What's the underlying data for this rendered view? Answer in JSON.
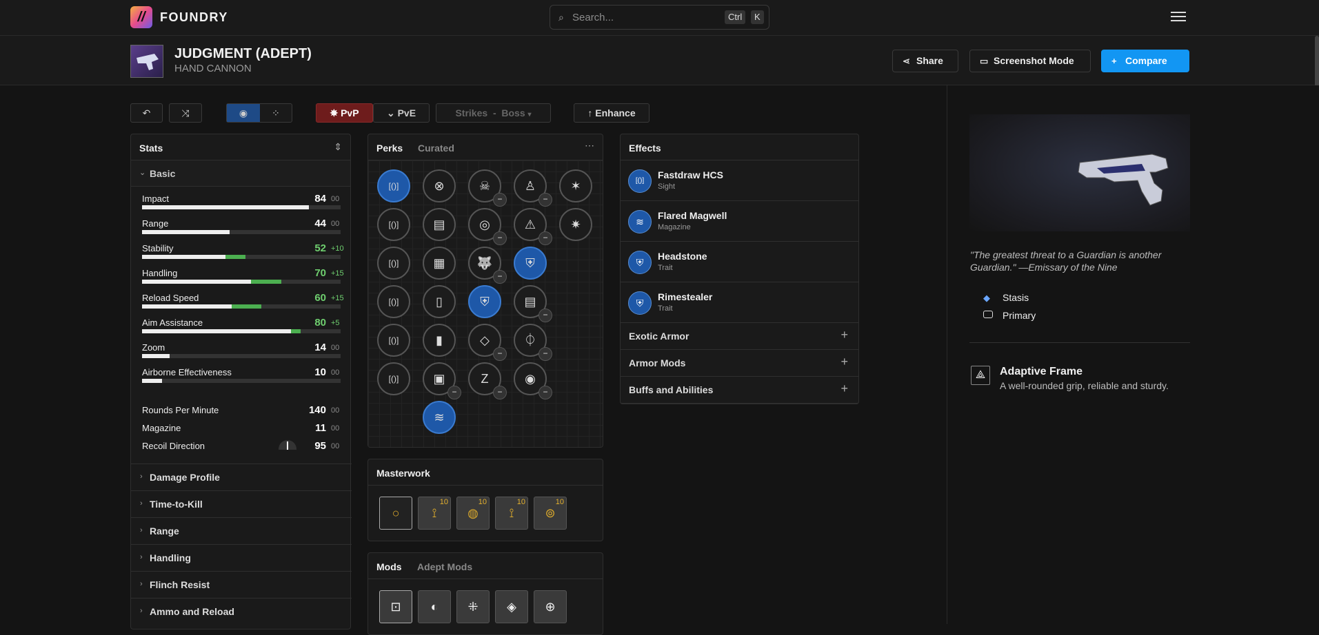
{
  "app": {
    "name": "FOUNDRY",
    "logo_glyph": "//"
  },
  "search": {
    "placeholder": "Search...",
    "shortcut_ctrl": "Ctrl",
    "shortcut_key": "K"
  },
  "weapon": {
    "name": "JUDGMENT (ADEPT)",
    "type": "HAND CANNON"
  },
  "header_actions": {
    "share": "Share",
    "screenshot_mode": "Screenshot Mode",
    "compare": "Compare"
  },
  "toolbar": {
    "pvp": "PvP",
    "pve": "PvE",
    "activity": "Strikes",
    "activity_sep": "-",
    "difficulty": "Boss",
    "enhance": "Enhance"
  },
  "stats": {
    "title": "Stats",
    "basic_label": "Basic",
    "bars": [
      {
        "name": "Impact",
        "value": "84",
        "extra": "00",
        "base": 84,
        "bonus": 0
      },
      {
        "name": "Range",
        "value": "44",
        "extra": "00",
        "base": 44,
        "bonus": 0
      },
      {
        "name": "Stability",
        "value": "52",
        "extra": "+10",
        "base": 42,
        "bonus": 10
      },
      {
        "name": "Handling",
        "value": "70",
        "extra": "+15",
        "base": 55,
        "bonus": 15
      },
      {
        "name": "Reload Speed",
        "value": "60",
        "extra": "+15",
        "base": 45,
        "bonus": 15
      },
      {
        "name": "Aim Assistance",
        "value": "80",
        "extra": "+5",
        "base": 75,
        "bonus": 5
      },
      {
        "name": "Zoom",
        "value": "14",
        "extra": "00",
        "base": 14,
        "bonus": 0
      },
      {
        "name": "Airborne Effectiveness",
        "value": "10",
        "extra": "00",
        "base": 10,
        "bonus": 0
      }
    ],
    "plain": [
      {
        "name": "Rounds Per Minute",
        "value": "140",
        "extra": "00"
      },
      {
        "name": "Magazine",
        "value": "11",
        "extra": "00"
      },
      {
        "name": "Recoil Direction",
        "value": "95",
        "extra": "00"
      }
    ],
    "sections": [
      "Damage Profile",
      "Time-to-Kill",
      "Range",
      "Handling",
      "Flinch Resist",
      "Ammo and Reload"
    ]
  },
  "perks": {
    "tab_perks": "Perks",
    "tab_curated": "Curated",
    "columns": [
      [
        "[()]",
        "[()]",
        "[()]",
        "[()]",
        "[()]",
        "[()]"
      ],
      [
        "⊗",
        "▤",
        "▦",
        "▯",
        "▮",
        "▣",
        "≋"
      ],
      [
        "☠",
        "◎",
        "🐺",
        "⛨",
        "◇",
        "Z"
      ],
      [
        "♙",
        "⚠",
        "⛨",
        "▤",
        "⏀",
        "◉"
      ],
      [
        "✶",
        "✷"
      ]
    ],
    "minus_label": "−"
  },
  "masterwork": {
    "title": "Masterwork",
    "level": "10",
    "icons": [
      "○",
      "⟟",
      "◍",
      "⟟",
      "⊚"
    ]
  },
  "mods": {
    "tab_mods": "Mods",
    "tab_adept": "Adept Mods",
    "icons": [
      "⊡",
      "◐",
      "⁜",
      "◈",
      "⊕"
    ]
  },
  "effects": {
    "title": "Effects",
    "items": [
      {
        "name": "Fastdraw HCS",
        "sub": "Sight",
        "icon": "[()]"
      },
      {
        "name": "Flared Magwell",
        "sub": "Magazine",
        "icon": "≋"
      },
      {
        "name": "Headstone",
        "sub": "Trait",
        "icon": "⛨"
      },
      {
        "name": "Rimestealer",
        "sub": "Trait",
        "icon": "⛨"
      }
    ],
    "accordions": [
      "Exotic Armor",
      "Armor Mods",
      "Buffs and Abilities"
    ]
  },
  "details": {
    "flavor": "\"The greatest threat to a Guardian is another Guardian.\" —Emissary of the Nine",
    "element": "Stasis",
    "ammo": "Primary",
    "frame_name": "Adaptive Frame",
    "frame_desc": "A well-rounded grip, reliable and sturdy."
  },
  "colors": {
    "accent": "#1296f3",
    "pvp": "#7a1f1f",
    "bonus": "#4caf50",
    "selected_perk": "#1e58a8"
  }
}
